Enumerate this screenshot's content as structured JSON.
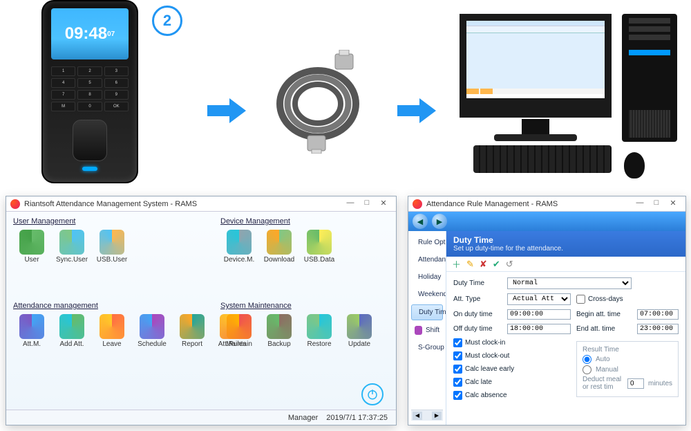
{
  "step_number": "2",
  "device": {
    "time": "09:48"
  },
  "windowA": {
    "title": "Riantsoft Attendance Management System - RAMS",
    "panels": {
      "user_mgmt": {
        "header": "User Management",
        "items": [
          "User",
          "Sync.User",
          "USB.User"
        ]
      },
      "device_mgmt": {
        "header": "Device Management",
        "items": [
          "Device.M.",
          "Download",
          "USB.Data"
        ]
      },
      "att_mgmt": {
        "header": "Attendance management",
        "items": [
          "Att.M.",
          "Add Att.",
          "Leave",
          "Schedule",
          "Report",
          "Att.Rules"
        ]
      },
      "sys_maint": {
        "header": "System Maintenance",
        "items": [
          "Maintain",
          "Backup",
          "Restore",
          "Update"
        ]
      }
    },
    "status": {
      "user": "Manager",
      "datetime": "2019/7/1  17:37:25"
    }
  },
  "windowB": {
    "title": "Attendance Rule Management - RAMS",
    "sidenav": [
      "Rule Options",
      "Attendance Item",
      "Holiday",
      "Weekend",
      "Duty Time",
      "Shift",
      "S-Group"
    ],
    "sidenav_active_index": 4,
    "section": {
      "title": "Duty Time",
      "subtitle": "Set up duty-time for the attendance."
    },
    "form": {
      "duty_time_label": "Duty Time",
      "duty_time_value": "Normal",
      "att_type_label": "Att. Type",
      "att_type_value": "Actual Att",
      "cross_days_label": "Cross-days",
      "cross_days_checked": false,
      "on_duty_label": "On duty time",
      "on_duty_value": "09:00:00",
      "off_duty_label": "Off duty time",
      "off_duty_value": "18:00:00",
      "begin_att_label": "Begin att. time",
      "begin_att_value": "07:00:00",
      "end_att_label": "End att. time",
      "end_att_value": "23:00:00",
      "checks": [
        {
          "label": "Must clock-in",
          "checked": true
        },
        {
          "label": "Must clock-out",
          "checked": true
        },
        {
          "label": "Calc leave early",
          "checked": true
        },
        {
          "label": "Calc late",
          "checked": true
        },
        {
          "label": "Calc absence",
          "checked": true
        }
      ],
      "result": {
        "header": "Result Time",
        "auto_label": "Auto",
        "manual_label": "Manual",
        "deduct_label": "Deduct meal or rest tim",
        "deduct_value": "0",
        "deduct_unit": "minutes"
      }
    }
  }
}
